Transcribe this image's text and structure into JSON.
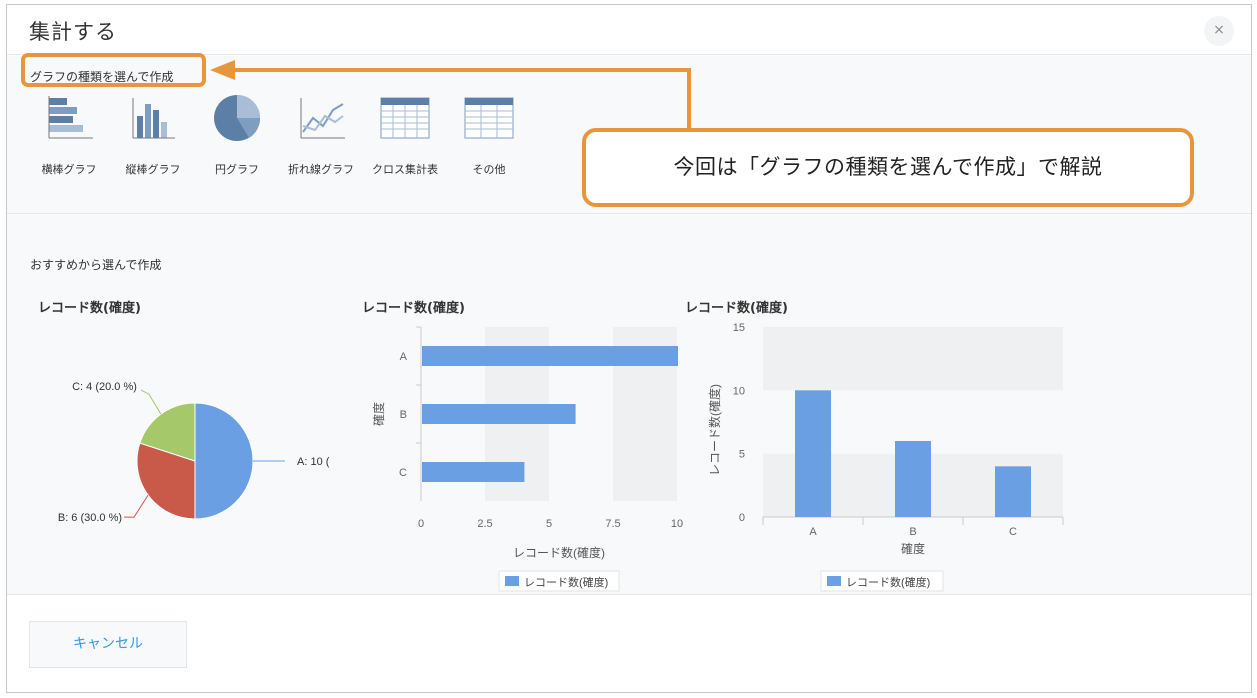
{
  "dialog": {
    "title": "集計する",
    "close_label": "×"
  },
  "chart_types": {
    "heading": "グラフの種類を選んで作成",
    "items": [
      {
        "label": "横棒グラフ",
        "icon": "horizontal-bar-icon"
      },
      {
        "label": "縦棒グラフ",
        "icon": "vertical-bar-icon"
      },
      {
        "label": "円グラフ",
        "icon": "pie-icon"
      },
      {
        "label": "折れ線グラフ",
        "icon": "line-icon"
      },
      {
        "label": "クロス集計表",
        "icon": "cross-table-icon"
      },
      {
        "label": "その他",
        "icon": "table-icon"
      }
    ]
  },
  "callout": {
    "text": "今回は「グラフの種類を選んで作成」で解説"
  },
  "recommend": {
    "heading": "おすすめから選んで作成",
    "chart_titles": [
      "レコード数(確度)",
      "レコード数(確度)",
      "レコード数(確度)"
    ]
  },
  "footer": {
    "cancel_label": "キャンセル"
  },
  "colors": {
    "accent_orange": "#e8963b",
    "bar_blue": "#6a9fe3",
    "pie_blue": "#6a9fe3",
    "pie_red": "#c95a4a",
    "pie_green": "#a5c86a",
    "link_blue": "#3498db"
  },
  "chart_data": [
    {
      "type": "pie",
      "title": "レコード数(確度)",
      "categories": [
        "A",
        "B",
        "C"
      ],
      "values": [
        10,
        6,
        4
      ],
      "labels": [
        "A: 10 (",
        "B: 6 (30.0 %)",
        "C: 4 (20.0 %)"
      ],
      "colors": [
        "#6a9fe3",
        "#c95a4a",
        "#a5c86a"
      ]
    },
    {
      "type": "bar",
      "orientation": "horizontal",
      "title": "レコード数(確度)",
      "categories": [
        "A",
        "B",
        "C"
      ],
      "values": [
        10,
        6,
        4
      ],
      "xlabel": "レコード数(確度)",
      "ylabel": "確度",
      "xlim": [
        0,
        10
      ],
      "xticks": [
        "0",
        "2.5",
        "5",
        "7.5",
        "10"
      ],
      "legend": "レコード数(確度)",
      "legend_position": "bottom"
    },
    {
      "type": "bar",
      "orientation": "vertical",
      "title": "レコード数(確度)",
      "categories": [
        "A",
        "B",
        "C"
      ],
      "values": [
        10,
        6,
        4
      ],
      "xlabel": "確度",
      "ylabel": "レコード数(確度)",
      "ylim": [
        0,
        15
      ],
      "yticks": [
        "0",
        "5",
        "10",
        "15"
      ],
      "legend": "レコード数(確度)",
      "legend_position": "bottom"
    }
  ]
}
